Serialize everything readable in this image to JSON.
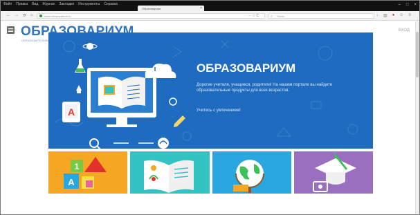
{
  "browser": {
    "menu": [
      "Файл",
      "Правка",
      "Вид",
      "Журнал",
      "Закладки",
      "Инструменты",
      "Справка"
    ],
    "tab_title": "Образовариум",
    "tab_close": "×",
    "window_controls": [
      "–",
      "□",
      "×"
    ],
    "url": "www.obrazovarium.ru",
    "url_actions": "··· ☆ C",
    "search_placeholder": "Поиск",
    "nav_icons": [
      "back-icon",
      "forward-icon",
      "reload-icon",
      "home-icon"
    ],
    "toolbar_icons": [
      "download-icon",
      "library-icon",
      "addon-icon",
      "sync-icon",
      "menu-icon"
    ]
  },
  "site": {
    "logo": "ОБРАЗОВАРИУМ",
    "tagline": "ОБРАЗОВАТЕЛЬНАЯ СРЕДА НОВОГО ПОКОЛЕНИЯ",
    "login": "ВХОД"
  },
  "banner": {
    "title": "ОБРАЗОВАРИУМ",
    "text": "Дорогие учителя, учащиеся, родители! На нашем портале вы найдете образовательные продукты для всех возрастов.",
    "cta": "Учитесь с увлечением!"
  },
  "tiles": [
    {
      "name": "preschool-tile",
      "color": "#f5a623"
    },
    {
      "name": "primary-school-tile",
      "color": "#33c3c3"
    },
    {
      "name": "school-tile",
      "color": "#29a7de"
    },
    {
      "name": "college-tile",
      "color": "#9b6fbf"
    }
  ],
  "colors": {
    "brand_blue": "#2f74c0",
    "banner_blue": "#1e6bbf"
  }
}
